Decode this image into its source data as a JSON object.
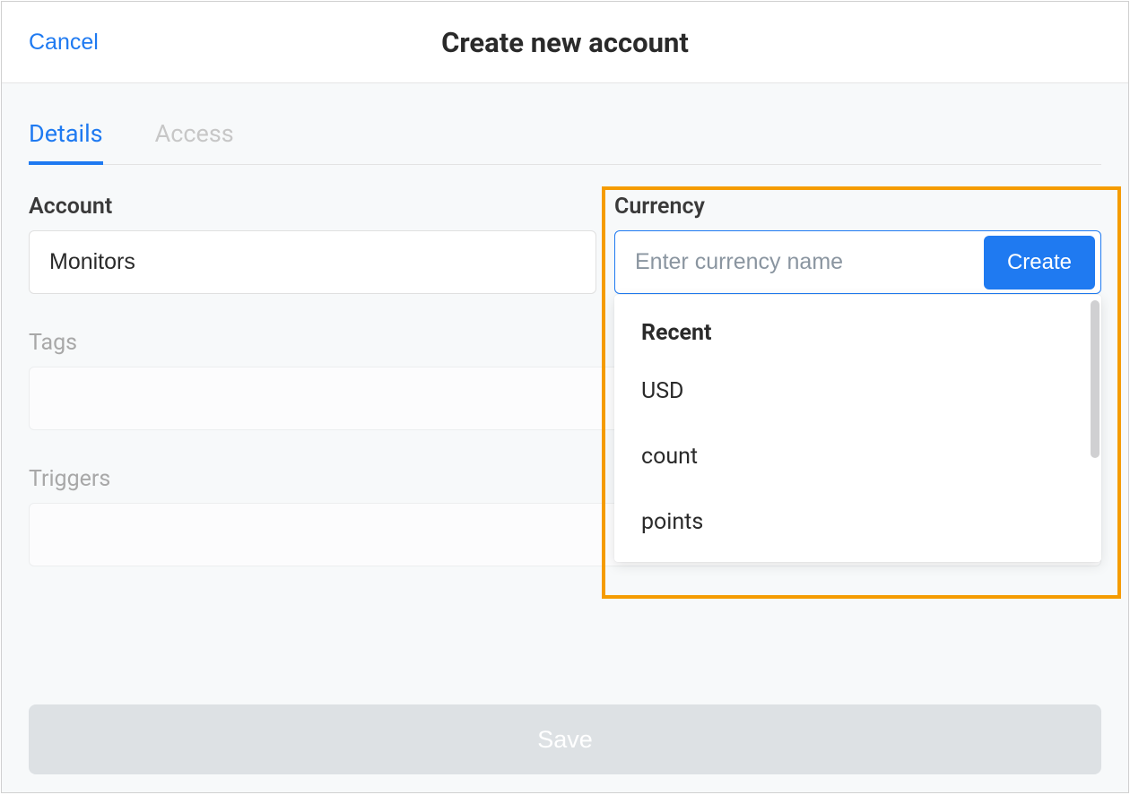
{
  "header": {
    "cancel_label": "Cancel",
    "title": "Create new account"
  },
  "tabs": [
    {
      "label": "Details",
      "active": true
    },
    {
      "label": "Access",
      "active": false
    }
  ],
  "form": {
    "account": {
      "label": "Account",
      "value": "Monitors"
    },
    "currency": {
      "label": "Currency",
      "placeholder": "Enter currency name",
      "create_label": "Create",
      "dropdown": {
        "header": "Recent",
        "items": [
          "USD",
          "count",
          "points"
        ]
      }
    },
    "tags": {
      "label": "Tags"
    },
    "triggers": {
      "label": "Triggers"
    }
  },
  "footer": {
    "save_label": "Save"
  }
}
